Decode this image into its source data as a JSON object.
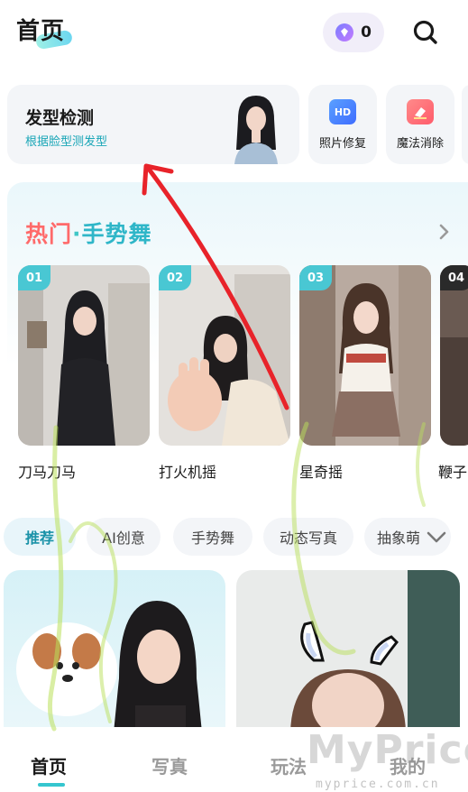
{
  "header": {
    "title": "首页",
    "coin_count": "0",
    "coin_icon": "gem-icon",
    "search_icon": "search-icon"
  },
  "tools": {
    "main": {
      "title": "发型检测",
      "subtitle": "根据脸型测发型"
    },
    "items": [
      {
        "label": "照片修复",
        "icon": "hd-icon",
        "icon_text": "HD",
        "color": "#4e8cff"
      },
      {
        "label": "魔法消除",
        "icon": "eraser-icon",
        "color": "#ff6b6b"
      }
    ]
  },
  "hot": {
    "title_a": "热门",
    "title_dot": "·",
    "title_b": "手势舞",
    "videos": [
      {
        "rank": "01",
        "label": "刀马刀马"
      },
      {
        "rank": "02",
        "label": "打火机摇"
      },
      {
        "rank": "03",
        "label": "星奇摇"
      },
      {
        "rank": "04",
        "label": "鞭子"
      }
    ]
  },
  "categories": [
    {
      "label": "推荐",
      "active": true
    },
    {
      "label": "AI创意",
      "active": false
    },
    {
      "label": "手势舞",
      "active": false
    },
    {
      "label": "动态写真",
      "active": false
    },
    {
      "label": "抽象萌",
      "active": false
    }
  ],
  "nav": [
    {
      "label": "首页",
      "active": true
    },
    {
      "label": "写真",
      "active": false
    },
    {
      "label": "玩法",
      "active": false
    },
    {
      "label": "我的",
      "active": false
    }
  ],
  "watermark": {
    "big": "MyPrice",
    "small": "myprice.com.cn"
  },
  "colors": {
    "accent": "#35c6cf",
    "hot_red": "#ff6a6a",
    "hot_teal": "#2fb6c8",
    "arrow_red": "#e8232a"
  }
}
